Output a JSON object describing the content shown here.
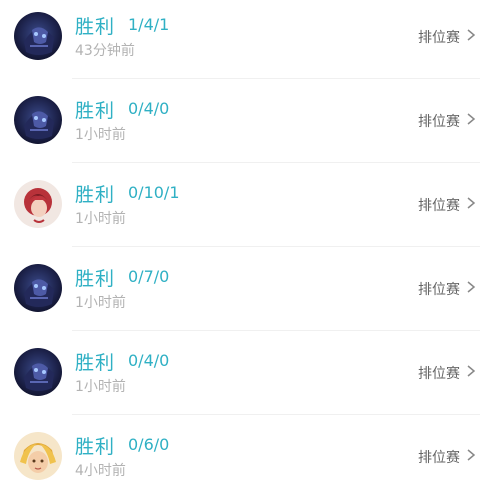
{
  "matches": [
    {
      "result": "胜利",
      "kda": "1/4/1",
      "time": "43分钟前",
      "mode": "排位赛",
      "hero_icon": "hero-avatar-dark-mage"
    },
    {
      "result": "胜利",
      "kda": "0/4/0",
      "time": "1小时前",
      "mode": "排位赛",
      "hero_icon": "hero-avatar-dark-mage"
    },
    {
      "result": "胜利",
      "kda": "0/10/1",
      "time": "1小时前",
      "mode": "排位赛",
      "hero_icon": "hero-avatar-red-hair"
    },
    {
      "result": "胜利",
      "kda": "0/7/0",
      "time": "1小时前",
      "mode": "排位赛",
      "hero_icon": "hero-avatar-dark-mage"
    },
    {
      "result": "胜利",
      "kda": "0/4/0",
      "time": "1小时前",
      "mode": "排位赛",
      "hero_icon": "hero-avatar-dark-mage"
    },
    {
      "result": "胜利",
      "kda": "0/6/0",
      "time": "4小时前",
      "mode": "排位赛",
      "hero_icon": "hero-avatar-blonde"
    }
  ],
  "colors": {
    "result": "#2fb0c4",
    "time": "#b3b3b3",
    "mode": "#666666",
    "divider": "#f0f0f0"
  }
}
